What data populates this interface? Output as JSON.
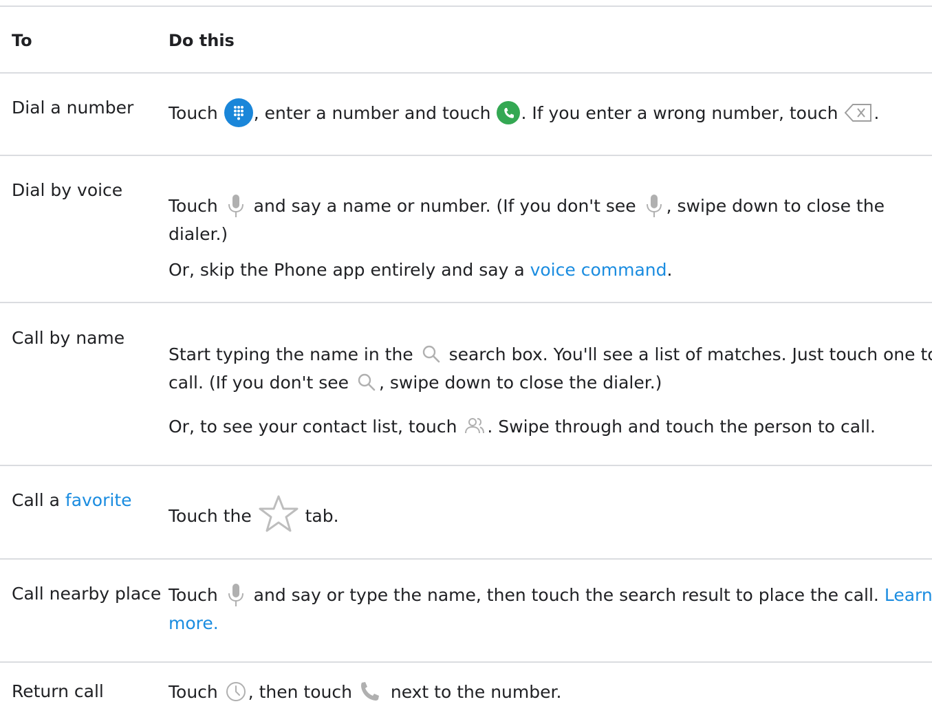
{
  "headers": {
    "to": "To",
    "do_this": "Do this"
  },
  "rows": {
    "dial_number": {
      "to": "Dial a number",
      "p1": "Touch ",
      "p2": ", enter a number and touch ",
      "p3": ". If you enter a wrong number, touch ",
      "p4": "."
    },
    "dial_voice": {
      "to": "Dial by voice",
      "l1a": "Touch ",
      "l1b": " and say a name or number. (If you don't see ",
      "l1c": ", swipe down to close the",
      "l2": "dialer.)",
      "l3a": "Or, skip the Phone app entirely and say a ",
      "l3_link": "voice command",
      "l3b": "."
    },
    "call_name": {
      "to": "Call by name",
      "l1a": "Start typing the name in the ",
      "l1b": " search box. You'll see a list of matches. Just touch one to",
      "l2a": "call. (If you don't see ",
      "l2b": ", swipe down to close the dialer.)",
      "l3a": "Or, to see your contact list, touch ",
      "l3b": ". Swipe through and touch the person to call."
    },
    "call_favorite": {
      "to_prefix": "Call a ",
      "to_link": "favorite",
      "p1": "Touch the ",
      "p2": " tab."
    },
    "call_nearby": {
      "to": "Call nearby place",
      "l1a": "Touch ",
      "l1b": " and say or type the name, then touch the search result to place the call. ",
      "l1_link": "Learn",
      "l2_link": "more."
    },
    "return_call": {
      "to": "Return call",
      "p1": "Touch ",
      "p2": ", then touch ",
      "p3": " next to the number."
    }
  },
  "icons": {
    "dialpad": "dialpad-icon",
    "call": "call-icon",
    "backspace": "backspace-icon",
    "mic": "mic-icon",
    "search": "search-icon",
    "contacts": "contacts-icon",
    "star": "star-icon",
    "recents": "clock-icon",
    "phone_handset": "phone-handset-icon"
  },
  "colors": {
    "link": "#1a8ce0",
    "dialpad_blue": "#1a86d9",
    "call_green": "#34a853",
    "rule": "#dadce0",
    "icon_gray": "#9e9e9e"
  }
}
